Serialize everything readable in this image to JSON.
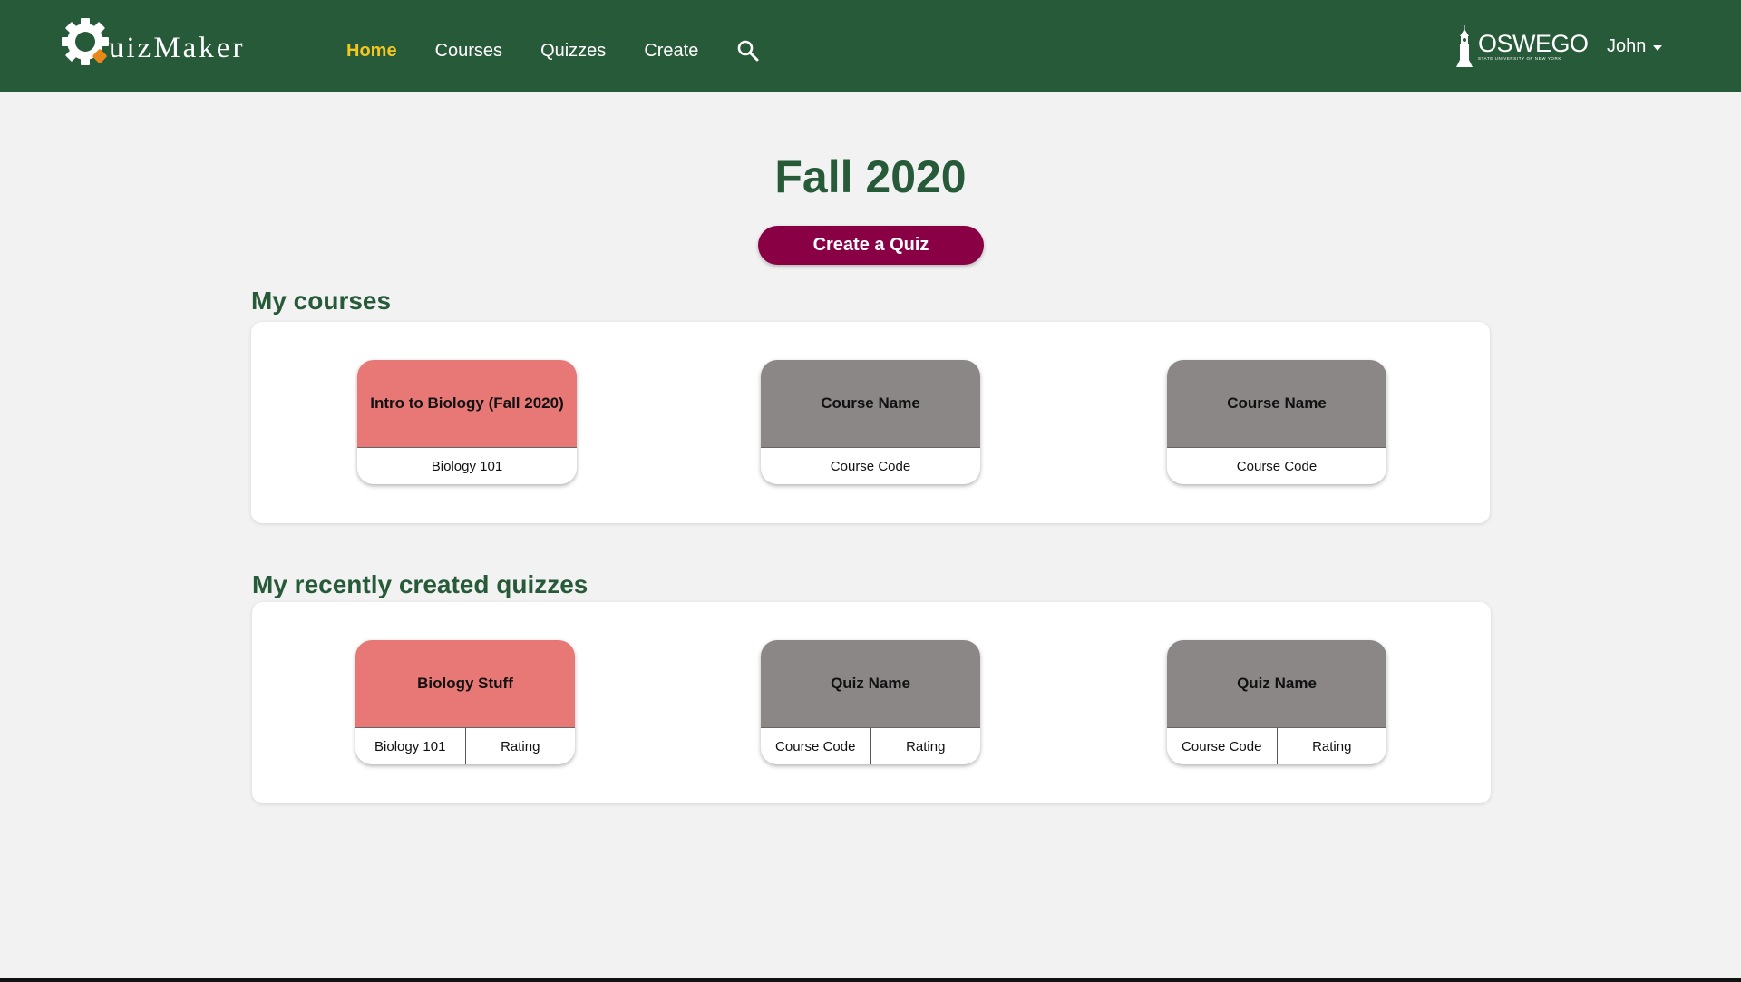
{
  "header": {
    "logo_text": "uizMaker",
    "nav": [
      {
        "label": "Home",
        "active": true
      },
      {
        "label": "Courses",
        "active": false
      },
      {
        "label": "Quizzes",
        "active": false
      },
      {
        "label": "Create",
        "active": false
      }
    ],
    "university": "OSWEGO",
    "university_sub": "STATE UNIVERSITY OF NEW YORK",
    "user": "John"
  },
  "main": {
    "title": "Fall 2020",
    "create_button": "Create a Quiz",
    "courses_title": "My courses",
    "courses": [
      {
        "name": "Intro to Biology (Fall 2020)",
        "code": "Biology 101",
        "color": "#e87876"
      },
      {
        "name": "Course Name",
        "code": "Course Code",
        "color": "#8b8786"
      },
      {
        "name": "Course Name",
        "code": "Course Code",
        "color": "#8b8786"
      }
    ],
    "quizzes_title": "My recently created quizzes",
    "quizzes": [
      {
        "name": "Biology Stuff",
        "code": "Biology 101",
        "rating": "Rating",
        "color": "#e87876"
      },
      {
        "name": "Quiz Name",
        "code": "Course Code",
        "rating": "Rating",
        "color": "#8b8786"
      },
      {
        "name": "Quiz Name",
        "code": "Course Code",
        "rating": "Rating",
        "color": "#8b8786"
      }
    ]
  },
  "colors": {
    "header_bg": "#275a38",
    "active_nav": "#f3c623",
    "primary_button": "#8a0045",
    "highlight_card": "#e87876",
    "placeholder_card": "#8b8786"
  }
}
